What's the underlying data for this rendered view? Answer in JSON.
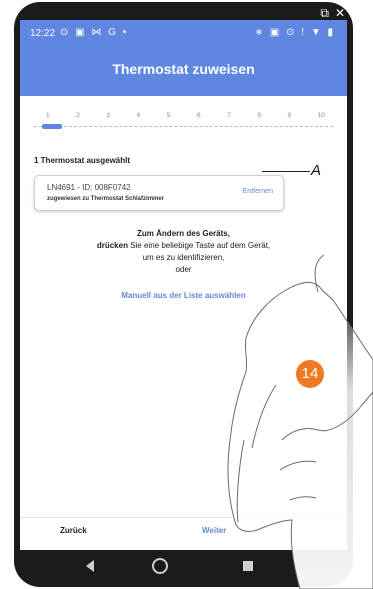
{
  "window": {
    "controls": [
      "⧉",
      "✕"
    ]
  },
  "statusbar": {
    "time": "12:22",
    "left_icons": "⊙ ▣ ⋈ G •",
    "right_icons": "∗ ▣ ⊙ ! ▼ ▮"
  },
  "appbar": {
    "title": "Thermostat zuweisen"
  },
  "stepper": {
    "steps": [
      "1",
      "2",
      "3",
      "4",
      "5",
      "6",
      "7",
      "8",
      "9",
      "10"
    ],
    "current": 1
  },
  "selection": {
    "count_label": "1 Thermostat ausgewählt",
    "device_id": "LN4691 - ID: 008F0742",
    "assigned_to": "zugewiesen zu Thermostat Schlafzimmer",
    "remove_label": "Entfernen"
  },
  "instructions": {
    "line1": "Zum Ändern des Geräts,",
    "line2_bold": "drücken",
    "line2_rest": " Sie eine beliebige Taste auf dem Gerät,",
    "line3": "um es zu identifizieren,",
    "line4": "oder"
  },
  "manual_select_label": "Manuell aus der Liste auswählen",
  "bottom": {
    "back_label": "Zurück",
    "next_label": "Weiter"
  },
  "annotations": {
    "callout_letter": "A",
    "step_number": "14",
    "step_color": "#f07a24"
  },
  "colors": {
    "primary": "#5f86e0",
    "link": "#6b86d6"
  }
}
